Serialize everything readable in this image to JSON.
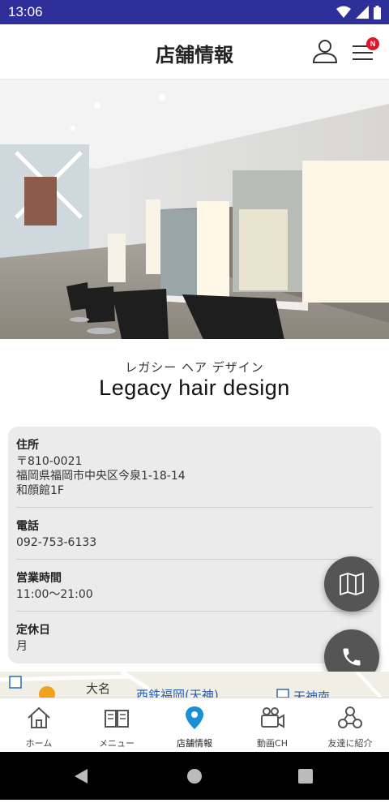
{
  "status": {
    "time": "13:06"
  },
  "header": {
    "title": "店舗情報",
    "badge": "N"
  },
  "shop": {
    "kana": "レガシー ヘア デザイン",
    "name": "Legacy hair design"
  },
  "info": {
    "address_label": "住所",
    "address_lines": [
      "〒810-0021",
      "福岡県福岡市中央区今泉1-18-14",
      "和顔館1F"
    ],
    "phone_label": "電話",
    "phone": "092-753-6133",
    "hours_label": "営業時間",
    "hours": "11:00〜21:00",
    "closed_label": "定休日",
    "closed": "月"
  },
  "map": {
    "labels": [
      "大名",
      "西鉄福岡(天神)",
      "天神南"
    ]
  },
  "tabs": [
    {
      "label": "ホーム",
      "icon": "home-icon"
    },
    {
      "label": "メニュー",
      "icon": "book-icon"
    },
    {
      "label": "店舗情報",
      "icon": "location-pin-icon",
      "active": true
    },
    {
      "label": "動画CH",
      "icon": "video-camera-icon"
    },
    {
      "label": "友達に紹介",
      "icon": "share-icon"
    }
  ],
  "colors": {
    "status_bar": "#2f2f9a",
    "accent": "#1a8fd6",
    "badge": "#e4132a",
    "fab": "#555555"
  }
}
